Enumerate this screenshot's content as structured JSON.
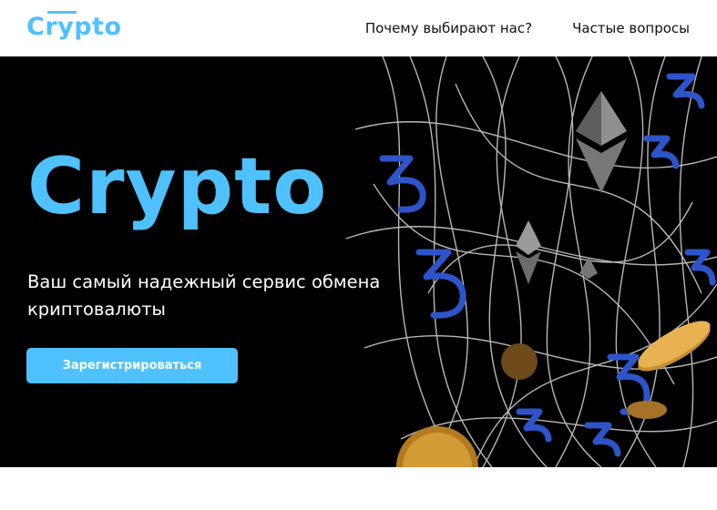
{
  "header": {
    "logo": "Crypto",
    "nav": [
      {
        "label": "Почему выбирают нас?"
      },
      {
        "label": "Частые вопросы"
      }
    ]
  },
  "hero": {
    "title": "Crypto",
    "subtitle": "Ваш самый надежный сервис обмена криптовалюты",
    "cta_label": "Зарегистрироваться"
  },
  "colors": {
    "accent": "#4fc1ff",
    "background": "#000000",
    "text_light": "#ffffff",
    "text_dark": "#111111"
  },
  "icons": [
    "crypto-coins-illustration",
    "ethereum-icon",
    "tezos-icon",
    "bitcoin-coin-icon"
  ]
}
